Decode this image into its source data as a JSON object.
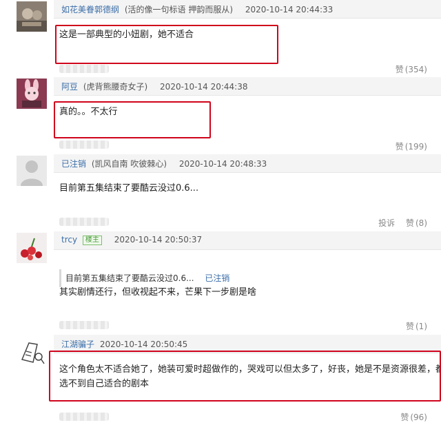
{
  "comments": [
    {
      "username": "如花美眷郭德纲",
      "signature": "(活的像一句标语 押韵而服从)",
      "time": "2020-10-14 20:44:33",
      "content": "这是一部典型的小妞剧，她不适合",
      "like_label": "赞",
      "like_count": "(354)"
    },
    {
      "username": "阿豆",
      "signature": "(虎背熊腰奇女子)",
      "time": "2020-10-14 20:44:38",
      "content": "真的。。不太行",
      "like_label": "赞",
      "like_count": "(199)"
    },
    {
      "username": "已注销",
      "signature": "(凯风自南 吹彼棘心)",
      "time": "2020-10-14 20:48:33",
      "content": "目前第五集结束了要酷云没过0.6...",
      "report_label": "投诉",
      "like_label": "赞",
      "like_count": "(8)"
    },
    {
      "username": "trcy",
      "badge": "楼主",
      "time": "2020-10-14 20:50:37",
      "quote_text": "目前第五集结束了要酷云没过0.6...",
      "quote_author": "已注销",
      "content": "其实剧情还行，但收视起不来，芒果下一步剧是啥",
      "like_label": "赞",
      "like_count": "(1)"
    },
    {
      "username": "江湖骗子",
      "time": "2020-10-14 20:50:45",
      "content_line1": "这个角色太不适合她了，她装可爱时超做作的，哭戏可以但太多了，好丧，她是不是资源很差，都",
      "content_line2": "选不到自己适合的剧本",
      "like_label": "赞",
      "like_count": "(96)"
    }
  ],
  "colors": {
    "username": "#3b6ea8",
    "header_bg": "#f4f4f4",
    "highlight_box": "#d0021b",
    "badge": "#4a9a3a"
  }
}
